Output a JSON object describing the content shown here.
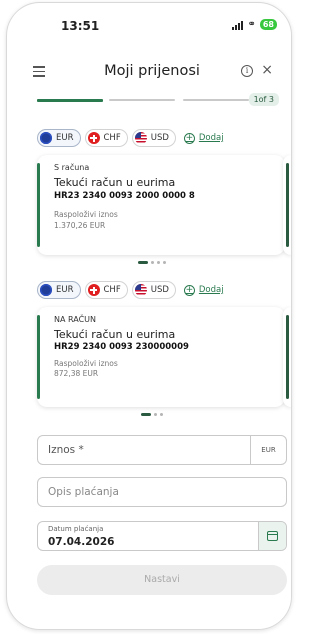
{
  "status_bar": {
    "time": "13:51",
    "battery": "68"
  },
  "header": {
    "title": "Moji prijenosi"
  },
  "progress": {
    "step_label": "1of 3",
    "current_step": 1,
    "total_steps": 3
  },
  "from_section": {
    "chips": [
      {
        "code": "EUR",
        "flag": "eu-flag-icon",
        "selected": true
      },
      {
        "code": "CHF",
        "flag": "swiss-flag-icon",
        "selected": false
      },
      {
        "code": "USD",
        "flag": "us-flag-icon",
        "selected": false
      }
    ],
    "add_label": "Dodaj",
    "account": {
      "label": "S računa",
      "name": "Tekući račun u eurima",
      "iban": "HR23 2340 0093 2000 0000 8",
      "available_label": "Raspoloživi iznos",
      "available_amount": "1.370,26 EUR"
    },
    "pager": {
      "count": 4,
      "active": 0
    }
  },
  "to_section": {
    "chips": [
      {
        "code": "EUR",
        "flag": "eu-flag-icon",
        "selected": true
      },
      {
        "code": "CHF",
        "flag": "swiss-flag-icon",
        "selected": false
      },
      {
        "code": "USD",
        "flag": "us-flag-icon",
        "selected": false
      }
    ],
    "add_label": "Dodaj",
    "account": {
      "label": "NA RAČUN",
      "name": "Tekući račun u eurima",
      "iban": "HR29 2340 0093 230000009",
      "available_label": "Raspoloživi iznos",
      "available_amount": "872,38 EUR"
    },
    "pager": {
      "count": 3,
      "active": 0
    }
  },
  "form": {
    "amount_placeholder": "Iznos *",
    "amount_currency": "EUR",
    "description_placeholder": "Opis plaćanja",
    "date_label": "Datum plaćanja",
    "date_value": "07.04.2026",
    "submit_label": "Nastavi"
  },
  "colors": {
    "accent": "#2a7a4f",
    "dark_accent": "#2a5a3f",
    "battery": "#37c83e",
    "disabled_button": "#ececec"
  }
}
